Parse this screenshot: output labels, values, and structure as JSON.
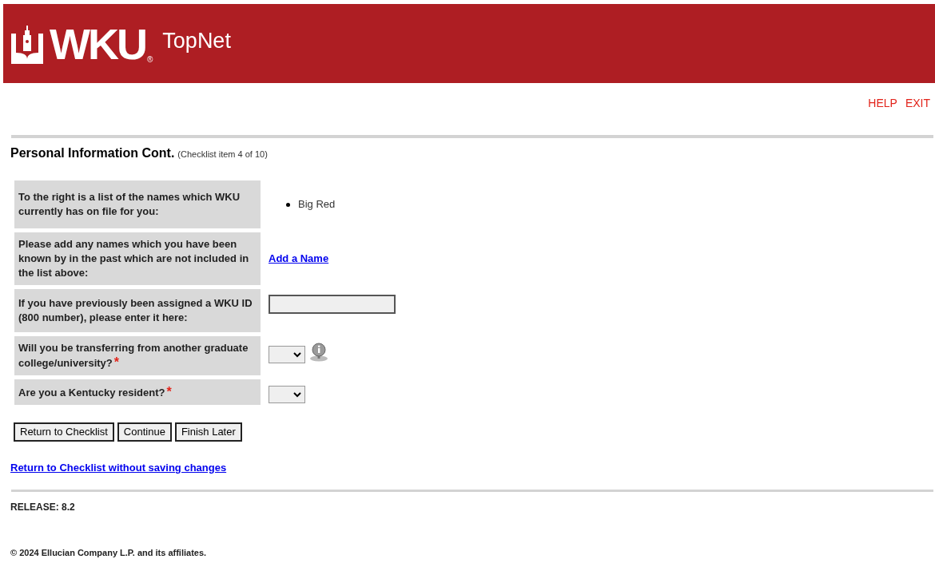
{
  "header": {
    "logo_text": "WKU",
    "registered_mark": "®",
    "product": "TopNet"
  },
  "top_links": [
    "HELP",
    "EXIT"
  ],
  "page_title": "Personal Information Cont.",
  "checklist_note": "(Checklist item 4 of 10)",
  "rows": [
    {
      "kind": "list",
      "label": "To the right is a list of the names which WKU currently has on file for you:",
      "required": false,
      "items": [
        "Big Red"
      ]
    },
    {
      "kind": "link",
      "label": "Please add any names which you have been known by in the past which are not included in the list above:",
      "required": false,
      "link": "Add a Name"
    },
    {
      "kind": "text_input",
      "label": "If you have previously been assigned a WKU ID (800 number), please enter it here:",
      "required": false
    },
    {
      "kind": "select",
      "label": "Will you be transferring from another graduate college/university?",
      "required": true,
      "info": true
    },
    {
      "kind": "select",
      "label": "Are you a Kentucky resident?",
      "required": true,
      "info": false
    }
  ],
  "required_mark": "*",
  "buttons": [
    "Return to Checklist",
    "Continue",
    "Finish Later"
  ],
  "bottom_link": "Return to Checklist without saving changes",
  "release": "RELEASE: 8.2",
  "copyright": "© 2024 Ellucian Company L.P. and its affiliates."
}
